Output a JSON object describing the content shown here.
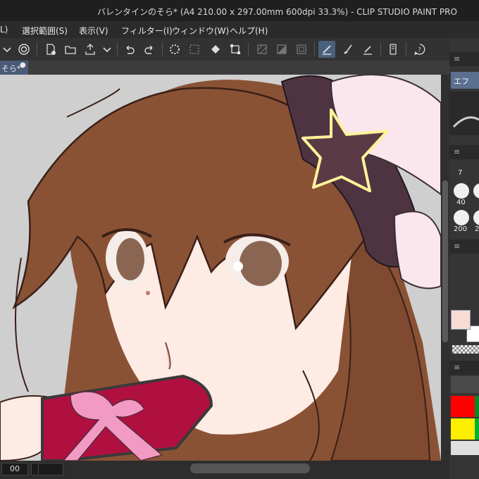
{
  "window": {
    "title": "バレンタインのそら* (A4 210.00 x 297.00mm 600dpi 33.3%)  - CLIP STUDIO PAINT PRO"
  },
  "menu": {
    "items": [
      "L)",
      "選択範囲(S)",
      "表示(V)",
      "フィルター(I)",
      "ウィンドウ(W)",
      "ヘルプ(H)"
    ]
  },
  "toolbar": {
    "icons": [
      "chevron-down-icon",
      "spiral-icon",
      "new-file-icon",
      "open-folder-icon",
      "export-icon",
      "chevron-down-icon",
      "undo-icon",
      "redo-icon",
      "loading-icon",
      "selection-icon",
      "fill-icon",
      "transform-icon",
      "hatch-icon",
      "tone-icon",
      "frame-icon",
      "ruler-pen-icon",
      "brush-icon",
      "pen-icon",
      "phone-icon",
      "help-icon"
    ]
  },
  "document_tab": {
    "label": "そら*",
    "close": "●"
  },
  "status": {
    "zoom": "00"
  },
  "right_panel": {
    "subtool_label": "エフ",
    "size_numbers": [
      "7",
      "40",
      "200",
      "2"
    ],
    "menu_glyph": "≡"
  },
  "colors": {
    "main_color": "#f8dcd4",
    "sub_color": "#ffffff",
    "palette": [
      "#ff0000",
      "#008a2a",
      "#ffee00",
      "#00b030",
      "#e0e0e0",
      "#e0e0e0"
    ],
    "canvas_bg": "#cfcfcf",
    "hair": "#8a5235",
    "bow": "#4e3440",
    "gift": "#b01040",
    "ribbon": "#f29ac4",
    "skin": "#fdebe4",
    "star": "#fff29a"
  }
}
